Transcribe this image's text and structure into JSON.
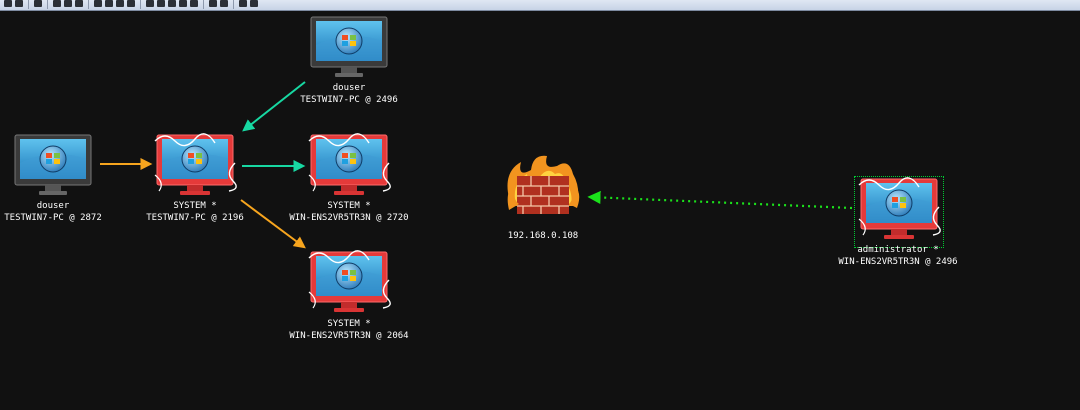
{
  "toolbar": {
    "buttons": [
      "new-connection",
      "disconnect",
      "headphones",
      "view-pivot-graph",
      "view-sessions",
      "view-targets",
      "console",
      "screenshot",
      "keylogger",
      "credentials",
      "script",
      "settings",
      "coffee",
      "web-drive-by",
      "notes",
      "shell",
      "link",
      "user",
      "script-console",
      "cube"
    ]
  },
  "colors": {
    "background": "#111111",
    "session_frame": "#e53a3a",
    "arrow_orange": "#f7a51e",
    "arrow_teal": "#17d8a2",
    "arrow_green_dotted": "#1be21b",
    "label_text": "#ffffff"
  },
  "nodes": [
    {
      "id": "n1",
      "icon": "monitor-idle-icon",
      "user": "douser",
      "host": "TESTWIN7-PC @ 2872"
    },
    {
      "id": "n2",
      "icon": "monitor-compromised-icon",
      "user": "SYSTEM *",
      "host": "TESTWIN7-PC @ 2196"
    },
    {
      "id": "n3",
      "icon": "monitor-idle-icon",
      "user": "douser",
      "host": "TESTWIN7-PC @ 2496"
    },
    {
      "id": "n4",
      "icon": "monitor-compromised-icon",
      "user": "SYSTEM *",
      "host": "WIN-ENS2VR5TR3N @ 2720"
    },
    {
      "id": "n5",
      "icon": "monitor-compromised-icon",
      "user": "SYSTEM *",
      "host": "WIN-ENS2VR5TR3N @ 2064"
    },
    {
      "id": "fw",
      "icon": "firewall-icon",
      "user": "",
      "host": "192.168.0.108"
    },
    {
      "id": "n6",
      "icon": "monitor-compromised-icon",
      "user": "administrator *",
      "host": "WIN-ENS2VR5TR3N @ 2496"
    }
  ],
  "edges": [
    {
      "from": "n1",
      "to": "n2",
      "color": "arrow_orange",
      "style": "solid"
    },
    {
      "from": "n3",
      "to": "n2",
      "color": "arrow_teal",
      "style": "solid"
    },
    {
      "from": "n2",
      "to": "n4",
      "color": "arrow_teal",
      "style": "solid"
    },
    {
      "from": "n2",
      "to": "n5",
      "color": "arrow_orange",
      "style": "solid"
    },
    {
      "from": "n6",
      "to": "fw",
      "color": "arrow_green_dotted",
      "style": "dotted"
    }
  ],
  "selected_node": "n6"
}
